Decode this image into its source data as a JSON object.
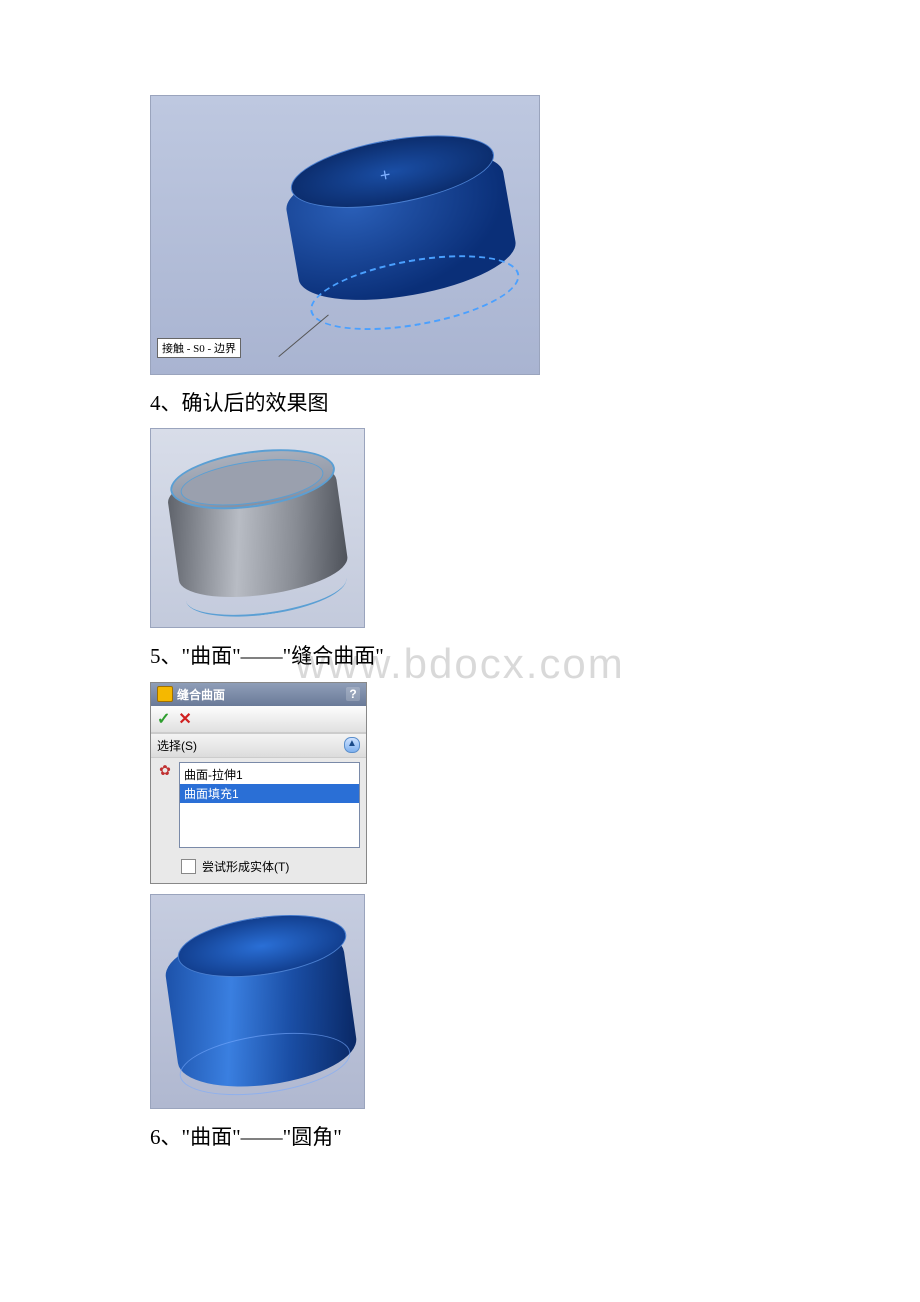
{
  "watermark": "www.bdocx.com",
  "fig1": {
    "tooltip": "接触 - S0 - 边界"
  },
  "step4": "4、确认后的效果图",
  "step5": "5、\"曲面\"——\"缝合曲面\"",
  "panel": {
    "title": "缝合曲面",
    "help": "?",
    "ok": "✓",
    "cancel": "✕",
    "section_label": "选择(S)",
    "collapse": "▲",
    "items": [
      "曲面-拉伸1",
      "曲面填充1"
    ],
    "checkbox_label": "尝试形成实体(T)"
  },
  "step6": "6、\"曲面\"——\"圆角\""
}
